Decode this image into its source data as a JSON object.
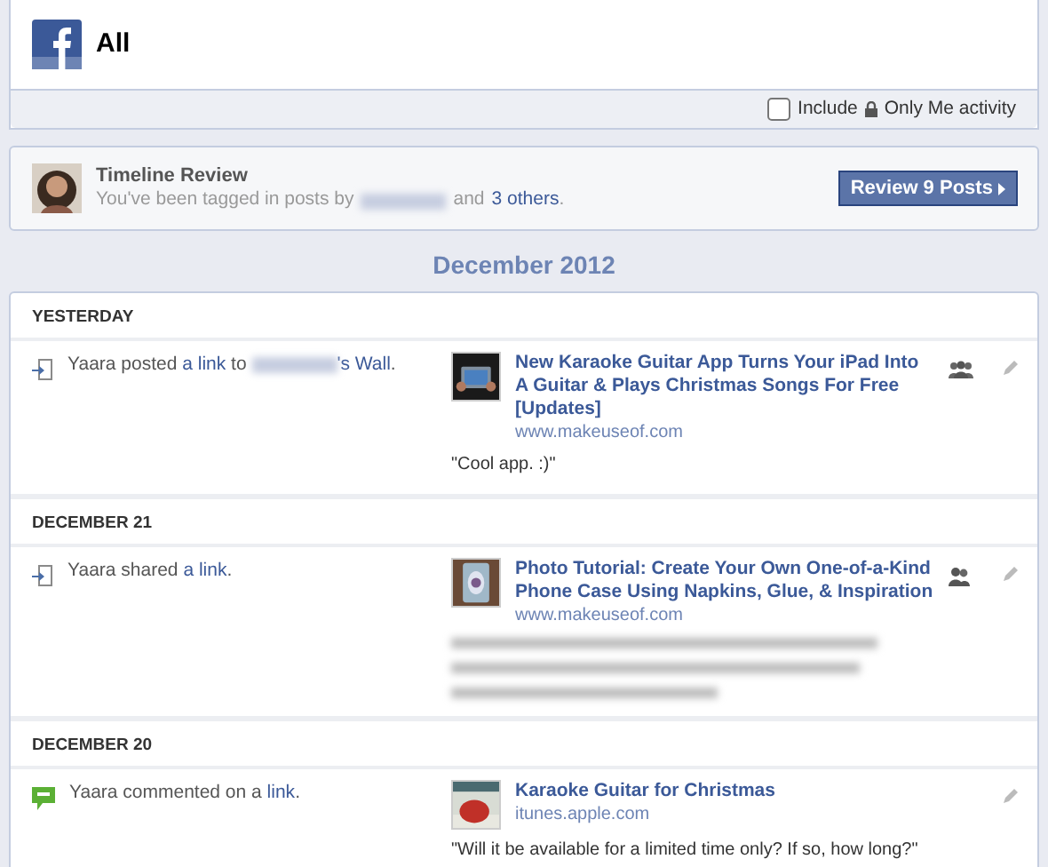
{
  "header": {
    "title": "All"
  },
  "filter": {
    "checked": false,
    "include": "Include",
    "only_me": "Only Me activity"
  },
  "review": {
    "title": "Timeline Review",
    "text": "You've been tagged in posts by",
    "and": "and",
    "others": "3 others",
    "end": ".",
    "button": "Review 9 Posts"
  },
  "month": "December 2012",
  "days": [
    {
      "label": "YESTERDAY",
      "items": [
        {
          "kind": "share",
          "story": [
            {
              "kind": "text",
              "text": "Yaara posted "
            },
            {
              "kind": "link",
              "text": "a link"
            },
            {
              "kind": "text",
              "text": " to "
            },
            {
              "kind": "blur"
            },
            {
              "kind": "link",
              "text": "'s Wall"
            },
            {
              "kind": "text",
              "text": "."
            }
          ],
          "preview": {
            "title": "New Karaoke Guitar App Turns Your iPad Into A Guitar & Plays Christmas Songs For Free [Updates]",
            "domain": "www.makeuseof.com",
            "comment": "\"Cool app. :)\""
          },
          "audience": {
            "kind": "group"
          }
        }
      ]
    },
    {
      "label": "DECEMBER 21",
      "items": [
        {
          "kind": "share",
          "story": [
            {
              "kind": "text",
              "text": "Yaara shared "
            },
            {
              "kind": "link",
              "text": "a link"
            },
            {
              "kind": "text",
              "text": "."
            }
          ],
          "preview": {
            "title": "Photo Tutorial: Create Your Own One-of-a-Kind Phone Case Using Napkins, Glue, & Inspiration",
            "domain": "www.makeuseof.com",
            "comment_blurred": true
          },
          "audience": {
            "kind": "friends"
          }
        }
      ]
    },
    {
      "label": "DECEMBER 20",
      "items": [
        {
          "kind": "comment",
          "story": [
            {
              "kind": "text",
              "text": "Yaara commented on a "
            },
            {
              "kind": "link",
              "text": "link"
            },
            {
              "kind": "text",
              "text": "."
            }
          ],
          "preview": {
            "title": "Karaoke Guitar for Christmas",
            "domain": "itunes.apple.com",
            "comment": "\"Will it be available for a limited time only? If so, how long?\""
          }
        }
      ]
    }
  ]
}
